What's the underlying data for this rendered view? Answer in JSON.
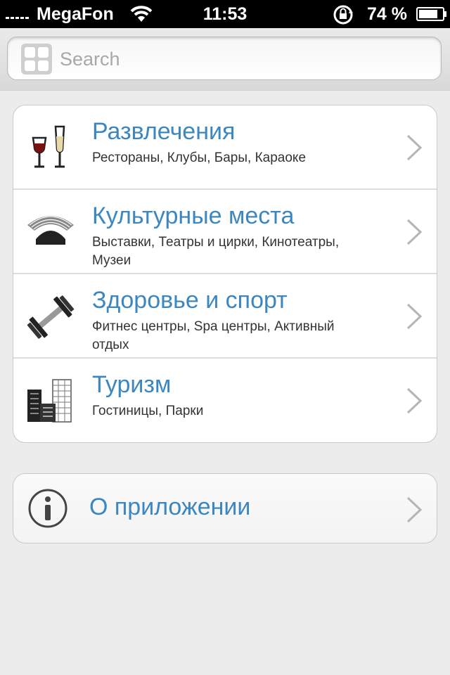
{
  "status": {
    "carrier": "MegaFon",
    "time": "11:53",
    "battery": "74 %"
  },
  "search": {
    "placeholder": "Search",
    "icon": "grid-icon"
  },
  "categories": [
    {
      "title": "Развлечения",
      "subtitle": "Рестораны, Клубы, Бары, Караоке",
      "icon": "wine-glasses-icon"
    },
    {
      "title": "Культурные места",
      "subtitle": "Выставки, Театры и цирки, Кинотеатры, Музеи",
      "icon": "theater-icon"
    },
    {
      "title": "Здоровье и спорт",
      "subtitle": "Фитнес центры, Spa центры, Активный отдых",
      "icon": "dumbbell-icon"
    },
    {
      "title": "Туризм",
      "subtitle": "Гостиницы, Парки",
      "icon": "buildings-icon"
    }
  ],
  "about": {
    "title": "О приложении",
    "icon": "info-icon"
  },
  "colors": {
    "accent": "#3c87c0",
    "background": "#ececec"
  }
}
